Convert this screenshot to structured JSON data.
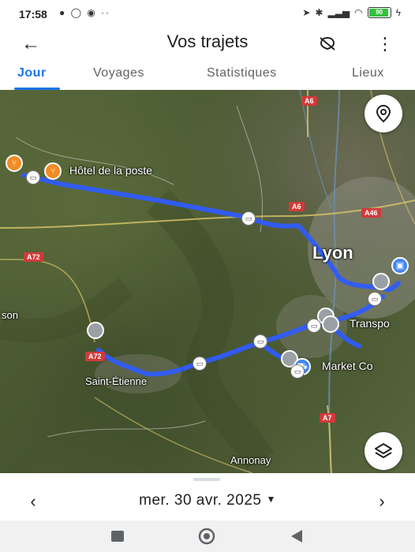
{
  "status_bar": {
    "time": "17:58",
    "left_icons": "● ◯ ◉ ··",
    "battery_label": "90"
  },
  "header": {
    "title": "Vos trajets",
    "back_icon": "arrow-left-icon",
    "location_off_icon": "location-off-icon",
    "more_icon": "more-vert-icon"
  },
  "tabs": [
    {
      "label": "Jour",
      "active": true
    },
    {
      "label": "Voyages",
      "active": false
    },
    {
      "label": "Statistiques",
      "active": false
    },
    {
      "label": "Lieux",
      "active": false
    }
  ],
  "map": {
    "places": {
      "hotel": "Hôtel de la poste",
      "transport": "Transpo",
      "market": "Market Co"
    },
    "cities": {
      "lyon": "Lyon",
      "saint_etienne": "Saint-Étienne",
      "annonay": "Annonay",
      "son": "son"
    },
    "roads": {
      "a6_top": "A6",
      "a6": "A6",
      "a46": "A46",
      "a72_left": "A72",
      "a72": "A72",
      "a7": "A7"
    },
    "route_color": "#2f5bff",
    "recenter_icon": "location-pin-icon",
    "layers_icon": "layers-icon"
  },
  "date_nav": {
    "date": "mer. 30 avr. 2025",
    "prev": "‹",
    "next": "›"
  },
  "colors": {
    "accent": "#1a73e8",
    "road_badge": "#d23a3a"
  }
}
